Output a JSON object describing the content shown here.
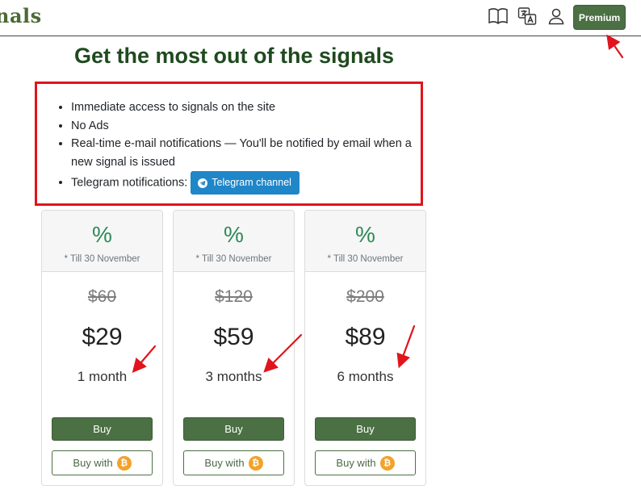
{
  "nav": {
    "brand": "nals",
    "icons": [
      "book-icon",
      "translate-icon",
      "user-icon"
    ],
    "premium_label": "Premium"
  },
  "headline": "Get the most out of the signals",
  "features": [
    "Immediate access to signals on the site",
    "No Ads",
    "Real-time e-mail notifications — You'll be notified by email when a new signal is issued",
    "Telegram notifications:"
  ],
  "telegram_button": "Telegram channel",
  "plans": [
    {
      "discount": "%",
      "note": "* Till 30 November",
      "old_price": "$60",
      "price": "$29",
      "duration": "1 month",
      "buy": "Buy",
      "buy_with": "Buy with"
    },
    {
      "discount": "%",
      "note": "* Till 30 November",
      "old_price": "$120",
      "price": "$59",
      "duration": "3 months",
      "buy": "Buy",
      "buy_with": "Buy with"
    },
    {
      "discount": "%",
      "note": "* Till 30 November",
      "old_price": "$200",
      "price": "$89",
      "duration": "6 months",
      "buy": "Buy",
      "buy_with": "Buy with"
    }
  ],
  "colors": {
    "brand_green": "#4b7043",
    "percent_green": "#2f8a58",
    "highlight_red": "#e0141c",
    "telegram_blue": "#1f86c8",
    "bitcoin_orange": "#f2a22b"
  }
}
